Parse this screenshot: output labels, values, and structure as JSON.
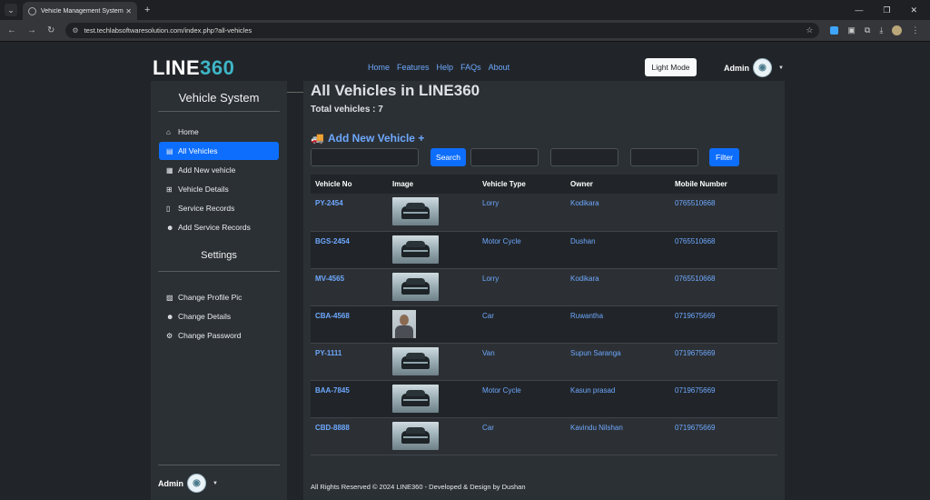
{
  "browser": {
    "tab_title": "Vehicle Management System",
    "url": "test.techlabsoftwaresolution.com/index.php?all-vehicles"
  },
  "header": {
    "logo_main": "LINE",
    "logo_accent": "360",
    "nav": [
      "Home",
      "Features",
      "Help",
      "FAQs",
      "About"
    ],
    "light_mode_label": "Light Mode",
    "user_label": "Admin"
  },
  "sidebar": {
    "title": "Vehicle System",
    "items": [
      {
        "label": "Home",
        "icon": "home-icon"
      },
      {
        "label": "All Vehicles",
        "icon": "id-card-icon",
        "active": true
      },
      {
        "label": "Add New vehicle",
        "icon": "calendar-icon"
      },
      {
        "label": "Vehicle Details",
        "icon": "table-icon"
      },
      {
        "label": "Service Records",
        "icon": "file-icon"
      },
      {
        "label": "Add Service Records",
        "icon": "user-plus-icon"
      }
    ],
    "settings_title": "Settings",
    "settings_items": [
      {
        "label": "Change Profile Pic",
        "icon": "image-icon"
      },
      {
        "label": "Change Details",
        "icon": "user-gear-icon"
      },
      {
        "label": "Change Password",
        "icon": "gear-icon"
      }
    ],
    "user_label": "Admin"
  },
  "main": {
    "title": "All Vehicles in LINE360",
    "total": "Total vehicles : 7",
    "add_new": "Add New Vehicle +",
    "search_label": "Search",
    "filter_label": "Filter",
    "columns": [
      "Vehicle No",
      "Image",
      "Vehicle Type",
      "Owner",
      "Mobile Number"
    ],
    "rows": [
      {
        "no": "PY-2454",
        "image": "car",
        "type": "Lorry",
        "owner": "Kodikara",
        "mobile": "0765510668"
      },
      {
        "no": "BGS-2454",
        "image": "car",
        "type": "Motor Cycle",
        "owner": "Dushan",
        "mobile": "0765510668"
      },
      {
        "no": "MV-4565",
        "image": "car",
        "type": "Lorry",
        "owner": "Kodikara",
        "mobile": "0765510668"
      },
      {
        "no": "CBA-4568",
        "image": "portrait",
        "type": "Car",
        "owner": "Ruwantha",
        "mobile": "0719675669"
      },
      {
        "no": "PY-1111",
        "image": "car",
        "type": "Van",
        "owner": "Supun Saranga",
        "mobile": "0719675669"
      },
      {
        "no": "BAA-7845",
        "image": "car",
        "type": "Motor Cycle",
        "owner": "Kasun prasad",
        "mobile": "0719675669"
      },
      {
        "no": "CBD-8888",
        "image": "car",
        "type": "Car",
        "owner": "Kavindu Nilshan",
        "mobile": "0719675669"
      }
    ]
  },
  "footer": {
    "text": "All Rights Reserved © 2024 LINE360 - Developed & Design by Dushan"
  }
}
